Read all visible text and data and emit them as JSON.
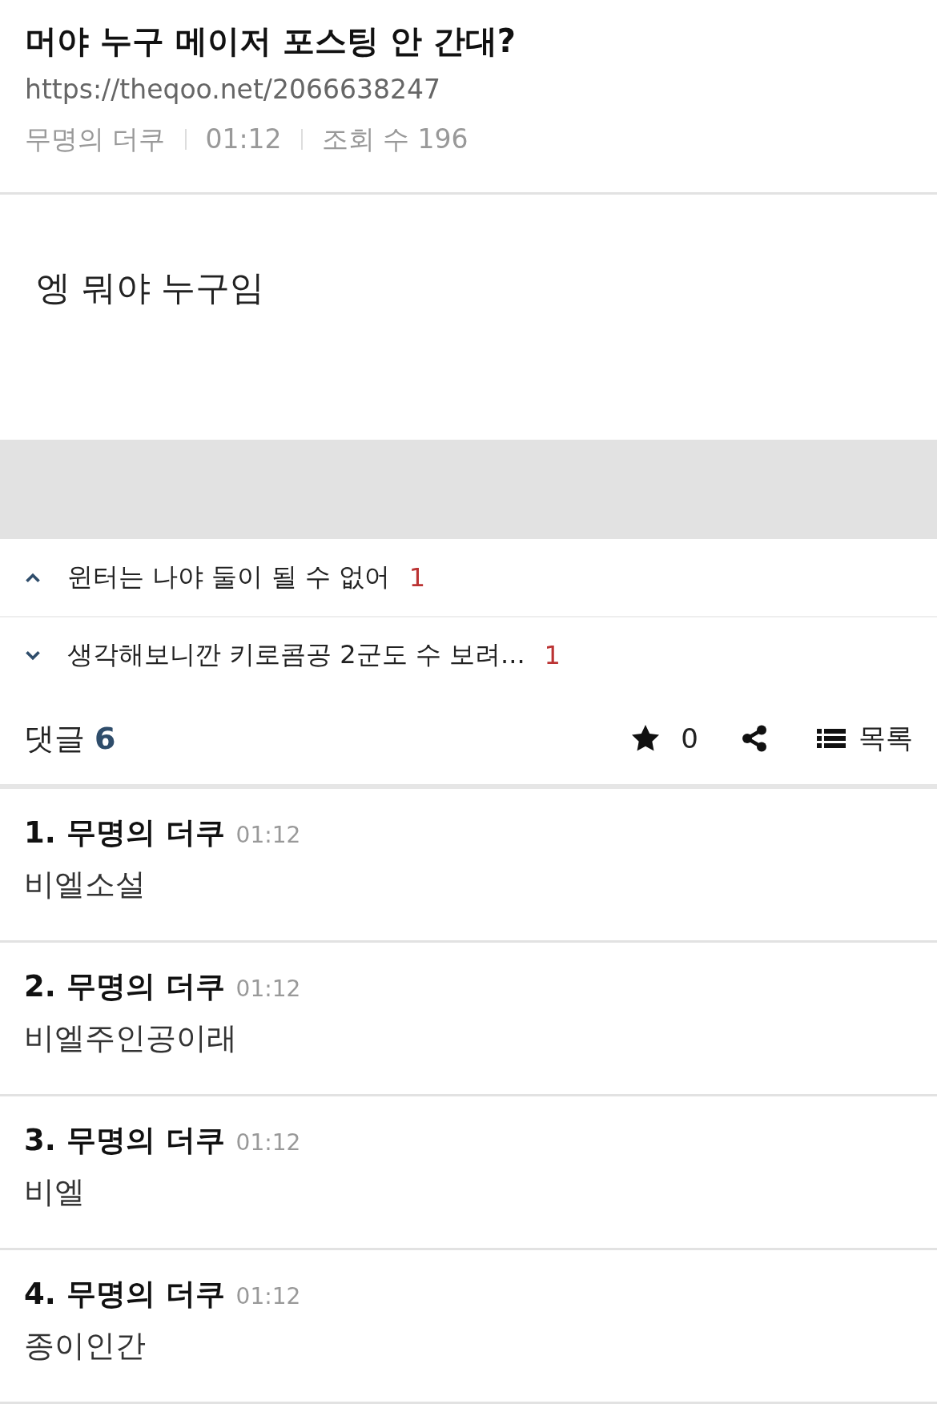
{
  "post": {
    "title": "머야 누구 메이저 포스팅 안 간대?",
    "url": "https://theqoo.net/2066638247",
    "meta": [
      "무명의 더쿠",
      "01:12",
      "조회 수 196"
    ],
    "body": "엥 뭐야 누구임"
  },
  "nav": [
    {
      "kind": "previous",
      "title": "윈터는 나야 둘이 될 수 없어",
      "count": "1"
    },
    {
      "kind": "next",
      "title": "생각해보니깐 키로콤공 2군도 수 보려...",
      "count": "1"
    }
  ],
  "comment_bar": {
    "label": "댓글",
    "count": "6",
    "favorites": "0",
    "list_label": "목록"
  },
  "comments": [
    {
      "name": "1. 무명의 더쿠",
      "time": "01:12",
      "text": "비엘소설"
    },
    {
      "name": "2. 무명의 더쿠",
      "time": "01:12",
      "text": "비엘주인공이래"
    },
    {
      "name": "3. 무명의 더쿠",
      "time": "01:12",
      "text": "비엘"
    },
    {
      "name": "4. 무명의 더쿠",
      "time": "01:12",
      "text": "종이인간"
    }
  ]
}
